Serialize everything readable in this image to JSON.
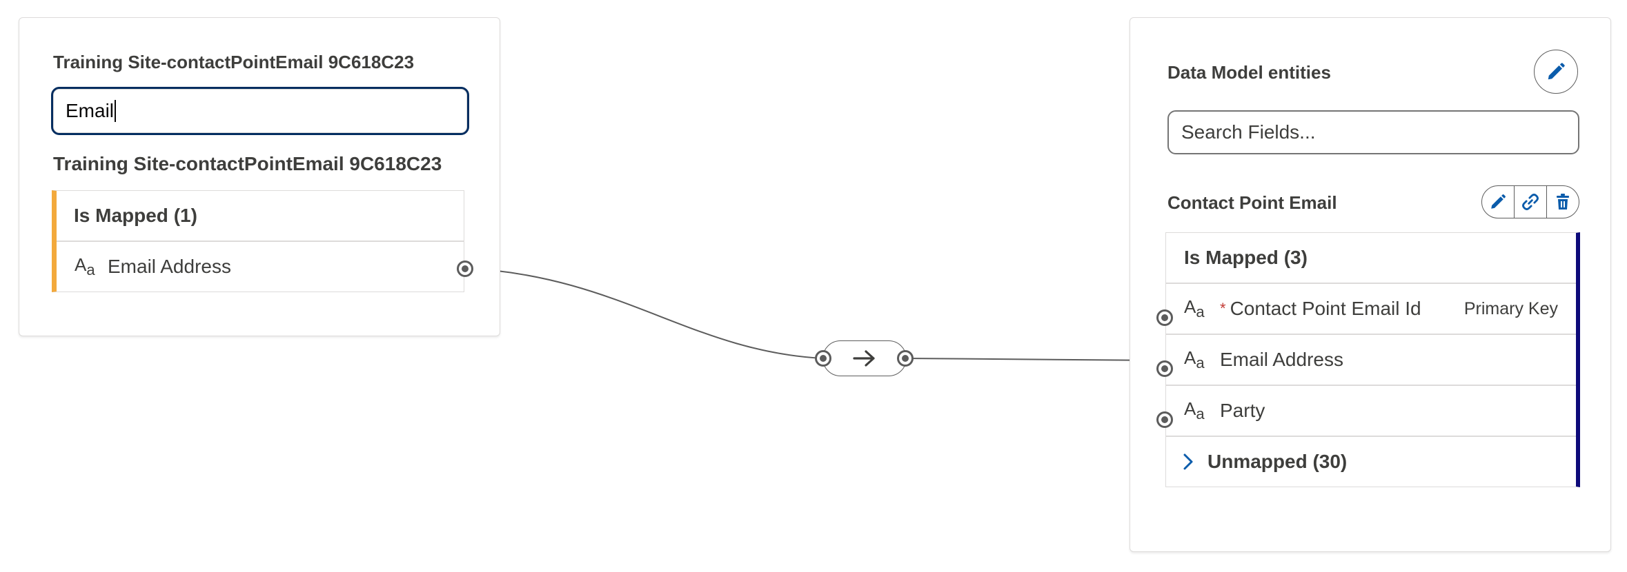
{
  "source": {
    "title": "Training Site-contactPointEmail 9C618C23",
    "search_value": "Email",
    "subtitle": "Training Site-contactPointEmail 9C618C23",
    "group_header": "Is Mapped (1)",
    "fields": [
      {
        "type_icon": "text-type-icon",
        "label": "Email Address"
      }
    ]
  },
  "target": {
    "title": "Data Model entities",
    "search_placeholder": "Search Fields...",
    "object_name": "Contact Point Email",
    "group_header": "Is Mapped (3)",
    "fields": [
      {
        "type_icon": "text-type-icon",
        "required_mark": "*",
        "label": "Contact Point Email Id",
        "tag": "Primary Key"
      },
      {
        "type_icon": "text-type-icon",
        "label": "Email Address"
      },
      {
        "type_icon": "text-type-icon",
        "label": "Party"
      }
    ],
    "unmapped_header": "Unmapped (30)"
  },
  "icons": {
    "edit": "pencil-icon",
    "link": "link-icon",
    "delete": "trash-icon",
    "transform": "arrow-right-icon",
    "expand": "chevron-right-icon"
  },
  "colors": {
    "accent_blue": "#0b5cab",
    "mapped_bar_source": "#f3a93c",
    "mapped_bar_target": "#0d0a7a",
    "required": "#c23934",
    "focus_border": "#032d60"
  },
  "type_icon_glyph": {
    "upper": "A",
    "lower": "a"
  }
}
